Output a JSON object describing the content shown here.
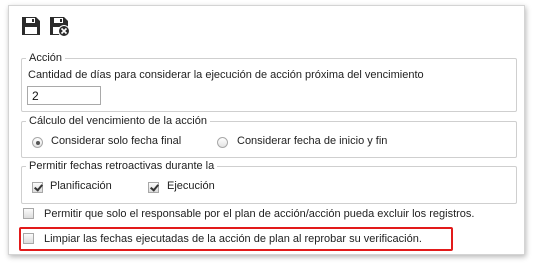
{
  "toolbar": {
    "save_icon": "save-icon",
    "save_close_icon": "save-close-icon"
  },
  "accion": {
    "legend": "Acción",
    "days_label": "Cantidad de días para considerar la ejecución de acción próxima del vencimiento",
    "days_value": "2"
  },
  "calculo": {
    "legend": "Cálculo del vencimiento de la acción",
    "option_end_label": "Considerar solo fecha final",
    "option_end_selected": true,
    "option_start_end_label": "Considerar fecha de inicio y fin",
    "option_start_end_selected": false
  },
  "fechas": {
    "legend": "Permitir fechas retroactivas durante la",
    "planificacion_label": "Planificación",
    "planificacion_checked": true,
    "ejecucion_label": "Ejecución",
    "ejecucion_checked": true
  },
  "options": {
    "responsable_label": "Permitir que solo el responsable por el plan de acción/acción pueda excluir los registros.",
    "responsable_checked": false,
    "limpiar_label": "Limpiar las fechas ejecutadas de la acción de plan al reprobar su verificación.",
    "limpiar_checked": false
  },
  "colors": {
    "highlight": "#e21a1a",
    "fieldset_border": "#cfcfcf"
  }
}
